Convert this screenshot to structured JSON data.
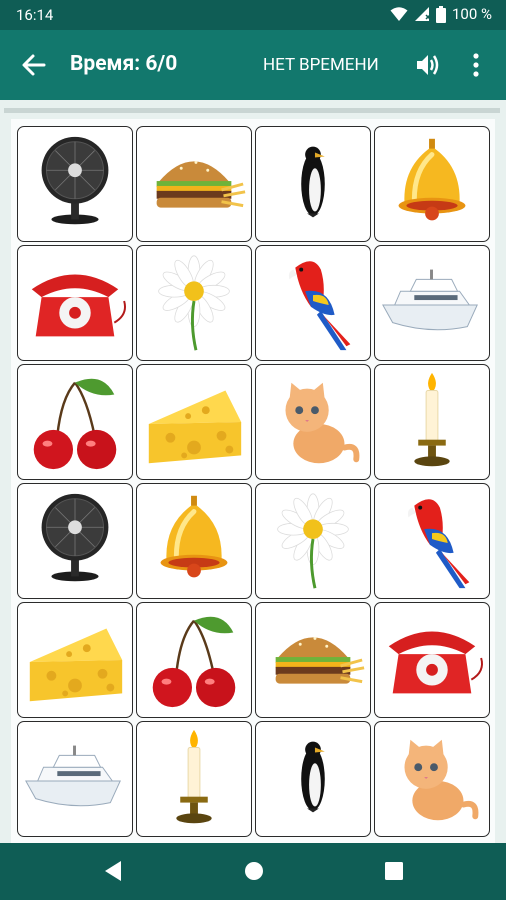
{
  "status_bar": {
    "time": "16:14",
    "battery": "100 %"
  },
  "app_bar": {
    "title": "Время: 6/0",
    "no_time_label": "НЕТ ВРЕМЕНИ"
  },
  "tiles": [
    [
      "fan",
      "burger",
      "penguin",
      "bell"
    ],
    [
      "telephone",
      "daisy",
      "parrot",
      "boat"
    ],
    [
      "cherries",
      "cheese",
      "kitten",
      "candle"
    ],
    [
      "fan",
      "bell",
      "daisy",
      "parrot"
    ],
    [
      "cheese",
      "cherries",
      "burger",
      "telephone"
    ],
    [
      "boat",
      "candle",
      "penguin",
      "kitten"
    ]
  ]
}
